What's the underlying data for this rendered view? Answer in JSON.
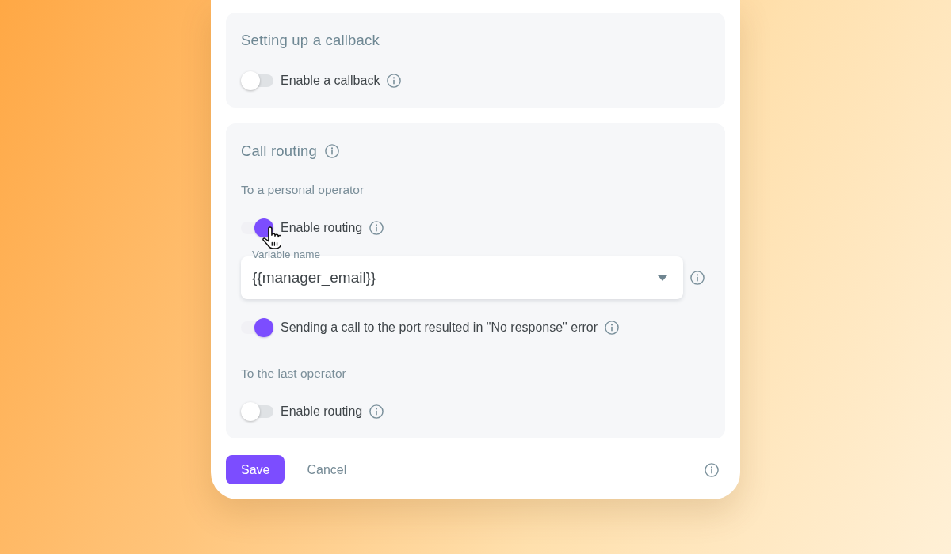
{
  "panels": [
    {
      "title": "Setting up a callback",
      "info": false,
      "blocks": [
        {
          "kind": "toggle",
          "label": "Enable a callback",
          "on": false
        }
      ]
    },
    {
      "title": "Call routing",
      "info": true,
      "blocks": [
        {
          "kind": "subheading",
          "text": "To a personal operator"
        },
        {
          "kind": "toggle",
          "label": "Enable routing",
          "on": true
        },
        {
          "kind": "select",
          "label": "Variable name",
          "value": "{{manager_email}}"
        },
        {
          "kind": "toggle",
          "label": "Sending a call to the port resulted in \"No response\" error",
          "on": true
        },
        {
          "kind": "subheading",
          "text": "To the last operator"
        },
        {
          "kind": "toggle",
          "label": "Enable routing",
          "on": false
        }
      ]
    }
  ],
  "footer": {
    "buttons": [
      {
        "kind": "primary",
        "label": "Save"
      },
      {
        "kind": "text",
        "label": "Cancel"
      }
    ]
  }
}
